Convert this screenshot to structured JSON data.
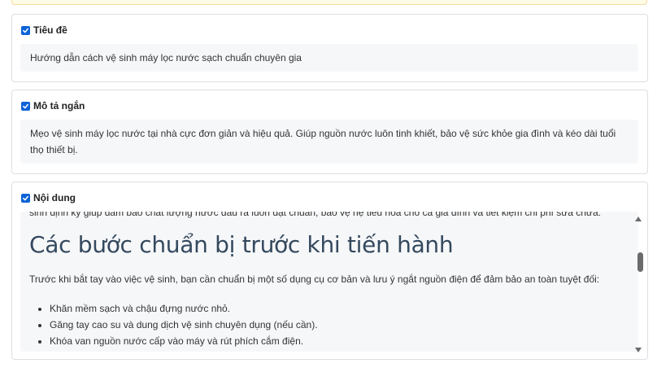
{
  "panels": {
    "title": {
      "label": "Tiêu đề",
      "checked": true,
      "value": "Hướng dẫn cách vệ sinh máy lọc nước sạch chuẩn chuyên gia"
    },
    "summary": {
      "label": "Mô tả ngắn",
      "checked": true,
      "value": "Mẹo vệ sinh máy lọc nước tại nhà cực đơn giản và hiệu quả. Giúp nguồn nước luôn tinh khiết, bảo vệ sức khỏe gia đình và kéo dài tuổi thọ thiết bị."
    },
    "content": {
      "label": "Nội dung",
      "checked": true,
      "lead_line": "sinh định kỳ giúp đảm bảo chất lượng nước đầu ra luôn đạt chuẩn, bảo vệ hệ tiêu hóa cho cả gia đình và tiết kiệm chi phí sửa chữa.",
      "heading": "Các bước chuẩn bị trước khi tiến hành",
      "paragraph": "Trước khi bắt tay vào việc vệ sinh, bạn cần chuẩn bị một số dụng cụ cơ bản và lưu ý ngắt nguồn điện để đảm bảo an toàn tuyệt đối:",
      "list": [
        "Khăn mềm sạch và chậu đựng nước nhỏ.",
        "Găng tay cao su và dung dịch vệ sinh chuyên dụng (nếu cần).",
        "Khóa van nguồn nước cấp vào máy và rút phích cắm điện."
      ]
    }
  },
  "icons": {
    "checkbox": "checkbox-checked-icon",
    "scroll_up": "triangle-up-icon",
    "scroll_down": "triangle-down-icon"
  },
  "colors": {
    "checkbox": "#0b63d6",
    "field_bg": "#f6f7f9",
    "heading": "#34495e"
  }
}
